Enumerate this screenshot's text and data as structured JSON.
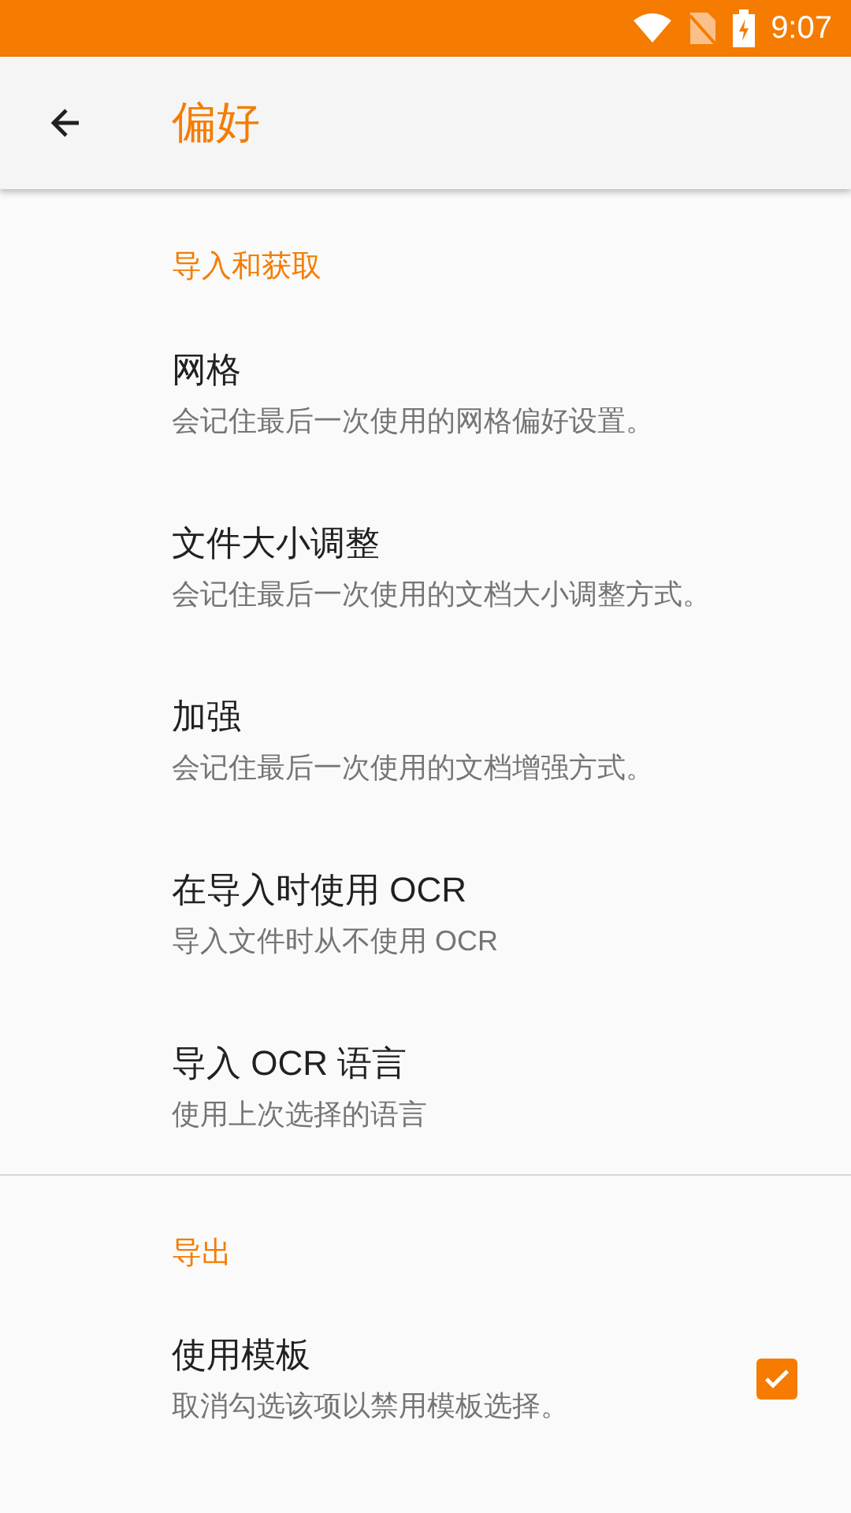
{
  "status_bar": {
    "time": "9:07"
  },
  "app_bar": {
    "title": "偏好"
  },
  "sections": [
    {
      "header": "导入和获取",
      "items": [
        {
          "kind": "text",
          "title": "网格",
          "summary": "会记住最后一次使用的网格偏好设置。"
        },
        {
          "kind": "text",
          "title": "文件大小调整",
          "summary": "会记住最后一次使用的文档大小调整方式。"
        },
        {
          "kind": "text",
          "title": "加强",
          "summary": "会记住最后一次使用的文档增强方式。"
        },
        {
          "kind": "text",
          "title": "在导入时使用 OCR",
          "summary": "导入文件时从不使用 OCR"
        },
        {
          "kind": "text",
          "title": "导入 OCR 语言",
          "summary": "使用上次选择的语言"
        }
      ]
    },
    {
      "header": "导出",
      "items": [
        {
          "kind": "checkbox",
          "title": "使用模板",
          "summary": "取消勾选该项以禁用模板选择。",
          "checked": true
        }
      ]
    }
  ]
}
